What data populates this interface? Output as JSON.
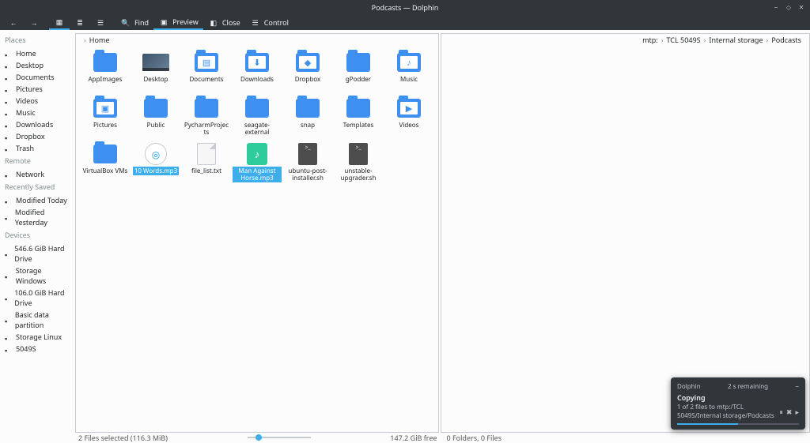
{
  "window": {
    "title": "Podcasts — Dolphin"
  },
  "toolbar": {
    "back": "",
    "fwd": "",
    "icons_label": "",
    "compact_label": "",
    "details_label": "",
    "find_label": "Find",
    "preview_label": "Preview",
    "close_label": "Close",
    "control_label": "Control"
  },
  "sidebar": {
    "places_hdr": "Places",
    "places": [
      {
        "label": "Home"
      },
      {
        "label": "Desktop"
      },
      {
        "label": "Documents"
      },
      {
        "label": "Pictures"
      },
      {
        "label": "Videos"
      },
      {
        "label": "Music"
      },
      {
        "label": "Downloads"
      },
      {
        "label": "Dropbox"
      },
      {
        "label": "Trash"
      }
    ],
    "remote_hdr": "Remote",
    "remote": [
      {
        "label": "Network"
      }
    ],
    "recent_hdr": "Recently Saved",
    "recent": [
      {
        "label": "Modified Today"
      },
      {
        "label": "Modified Yesterday"
      }
    ],
    "devices_hdr": "Devices",
    "devices": [
      {
        "label": "546.6 GiB Hard Drive"
      },
      {
        "label": "Storage Windows"
      },
      {
        "label": "106.0 GiB Hard Drive"
      },
      {
        "label": "Basic data partition"
      },
      {
        "label": "Storage Linux"
      },
      {
        "label": "5049S"
      }
    ]
  },
  "left_pane": {
    "breadcrumb": [
      "Home"
    ],
    "items": [
      {
        "label": "AppImages",
        "type": "folder"
      },
      {
        "label": "Desktop",
        "type": "desktop"
      },
      {
        "label": "Documents",
        "type": "folder-g",
        "g": "▤"
      },
      {
        "label": "Downloads",
        "type": "folder-g",
        "g": "⬇"
      },
      {
        "label": "Dropbox",
        "type": "folder-g",
        "g": "◆"
      },
      {
        "label": "gPodder",
        "type": "folder"
      },
      {
        "label": "Music",
        "type": "folder-g",
        "g": "♪"
      },
      {
        "label": "Pictures",
        "type": "folder-g",
        "g": "▣"
      },
      {
        "label": "Public",
        "type": "folder"
      },
      {
        "label": "PycharmProjects",
        "type": "folder"
      },
      {
        "label": "seagate-external",
        "type": "folder"
      },
      {
        "label": "snap",
        "type": "folder"
      },
      {
        "label": "Templates",
        "type": "folder"
      },
      {
        "label": "Videos",
        "type": "folder-g",
        "g": "▶"
      },
      {
        "label": "VirtualBox VMs",
        "type": "folder"
      },
      {
        "label": "10 Words.mp3",
        "type": "appimg",
        "selected": true
      },
      {
        "label": "file_list.txt",
        "type": "filedoc"
      },
      {
        "label": "Man Against Horse.mp3",
        "type": "audio",
        "selected": true
      },
      {
        "label": "ubuntu-post-installer.sh",
        "type": "sh"
      },
      {
        "label": "unstable-upgrader.sh",
        "type": "sh"
      }
    ]
  },
  "right_pane": {
    "breadcrumb": [
      "mtp:",
      "TCL 5049S",
      "Internal storage",
      "Podcasts"
    ]
  },
  "status": {
    "left": "2 Files selected (116.3 MiB)",
    "free": "147.2 GiB free",
    "right": "0 Folders, 0 Files"
  },
  "notify": {
    "app": "Dolphin",
    "remaining": "2 s remaining",
    "title": "Copying",
    "detail": "1 of 2 files to mtp:/TCL 5049S/Internal storage/Podcasts"
  }
}
